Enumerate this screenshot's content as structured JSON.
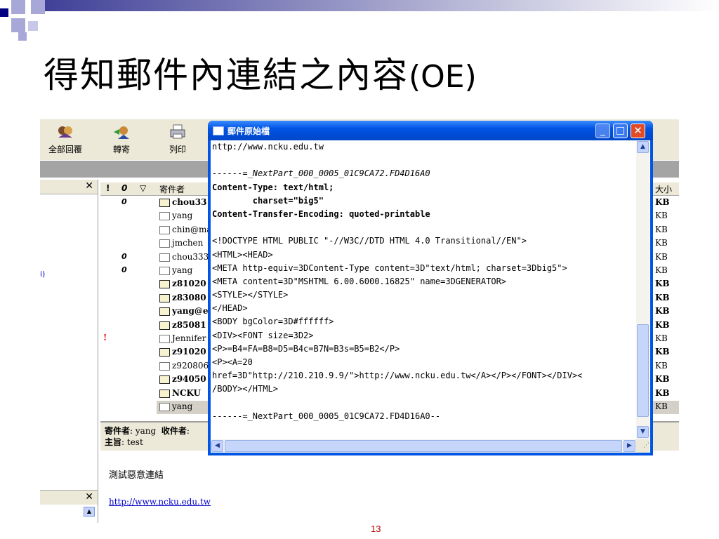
{
  "slide": {
    "title_cjk": "得知郵件內連結之內容",
    "title_latin": "(OE)",
    "page_number": "13"
  },
  "toolbar": {
    "reply_all": "全部回覆",
    "forward": "轉寄",
    "print": "列印"
  },
  "message_list": {
    "header_from": "寄件者",
    "header_size": "大小",
    "rows": [
      {
        "from": "chou33",
        "size": "KB",
        "bold": true,
        "attach": true,
        "flag": false
      },
      {
        "from": "yang",
        "size": "KB",
        "bold": false,
        "attach": false,
        "flag": false
      },
      {
        "from": "chin@ma",
        "size": "KB",
        "bold": false,
        "attach": false,
        "flag": false
      },
      {
        "from": "jmchen",
        "size": "KB",
        "bold": false,
        "attach": false,
        "flag": false
      },
      {
        "from": "chou333",
        "size": "KB",
        "bold": false,
        "attach": true,
        "flag": false
      },
      {
        "from": "yang",
        "size": "KB",
        "bold": false,
        "attach": true,
        "flag": false
      },
      {
        "from": "z81020",
        "size": "KB",
        "bold": true,
        "attach": false,
        "flag": false
      },
      {
        "from": "z83080",
        "size": "KB",
        "bold": true,
        "attach": false,
        "flag": false
      },
      {
        "from": "yang@e",
        "size": "KB",
        "bold": true,
        "attach": false,
        "flag": false
      },
      {
        "from": "z85081",
        "size": "KB",
        "bold": true,
        "attach": false,
        "flag": false
      },
      {
        "from": "Jennifer",
        "size": "KB",
        "bold": false,
        "attach": false,
        "flag": true
      },
      {
        "from": "z91020",
        "size": "KB",
        "bold": true,
        "attach": false,
        "flag": false
      },
      {
        "from": "z920806",
        "size": "KB",
        "bold": false,
        "attach": false,
        "flag": false
      },
      {
        "from": "z94050",
        "size": "KB",
        "bold": true,
        "attach": false,
        "flag": false
      },
      {
        "from": "NCKU",
        "size": "KB",
        "bold": true,
        "attach": false,
        "flag": false
      },
      {
        "from": "yang",
        "size": "KB",
        "bold": false,
        "attach": false,
        "flag": false,
        "selected": true
      }
    ]
  },
  "preview": {
    "from_label": "寄件者",
    "from_value": "yang",
    "to_label": "收件者",
    "subject_label": "主旨",
    "subject_value": "test",
    "body": "測試惡意連結",
    "link": "http://www.ncku.edu.tw"
  },
  "source_window": {
    "title": "郵件原始檔",
    "lines": [
      {
        "text": "nttp://www.ncku.edu.tw",
        "style": "plain"
      },
      {
        "text": "",
        "style": "plain"
      },
      {
        "text": "------=_NextPart_000_0005_01C9CA72.FD4D16A0",
        "style": "ital"
      },
      {
        "text": "Content-Type: text/html;",
        "style": "bold"
      },
      {
        "text": "        charset=\"big5\"",
        "style": "bold"
      },
      {
        "text": "Content-Transfer-Encoding: quoted-printable",
        "style": "bold"
      },
      {
        "text": "",
        "style": "plain"
      },
      {
        "text": "<!DOCTYPE HTML PUBLIC \"-//W3C//DTD HTML 4.0 Transitional//EN\">",
        "style": "plain"
      },
      {
        "text": "<HTML><HEAD>",
        "style": "plain"
      },
      {
        "text": "<META http-equiv=3DContent-Type content=3D\"text/html; charset=3Dbig5\">",
        "style": "plain"
      },
      {
        "text": "<META content=3D\"MSHTML 6.00.6000.16825\" name=3DGENERATOR>",
        "style": "plain"
      },
      {
        "text": "<STYLE></STYLE>",
        "style": "plain"
      },
      {
        "text": "</HEAD>",
        "style": "plain"
      },
      {
        "text": "<BODY bgColor=3D#ffffff>",
        "style": "plain"
      },
      {
        "text": "<DIV><FONT size=3D2>",
        "style": "plain"
      },
      {
        "text": "<P>=B4=FA=B8=D5=B4c=B7N=B3s=B5=B2</P>",
        "style": "plain"
      },
      {
        "text": "<P><A=20",
        "style": "plain"
      },
      {
        "text": "href=3D\"http://210.210.9.9/\">http://www.ncku.edu.tw</A></P></FONT></DIV><",
        "style": "plain"
      },
      {
        "text": "/BODY></HTML>",
        "style": "plain"
      },
      {
        "text": "",
        "style": "plain"
      },
      {
        "text": "------=_NextPart_000_0005_01C9CA72.FD4D16A0--",
        "style": "plain"
      }
    ]
  }
}
